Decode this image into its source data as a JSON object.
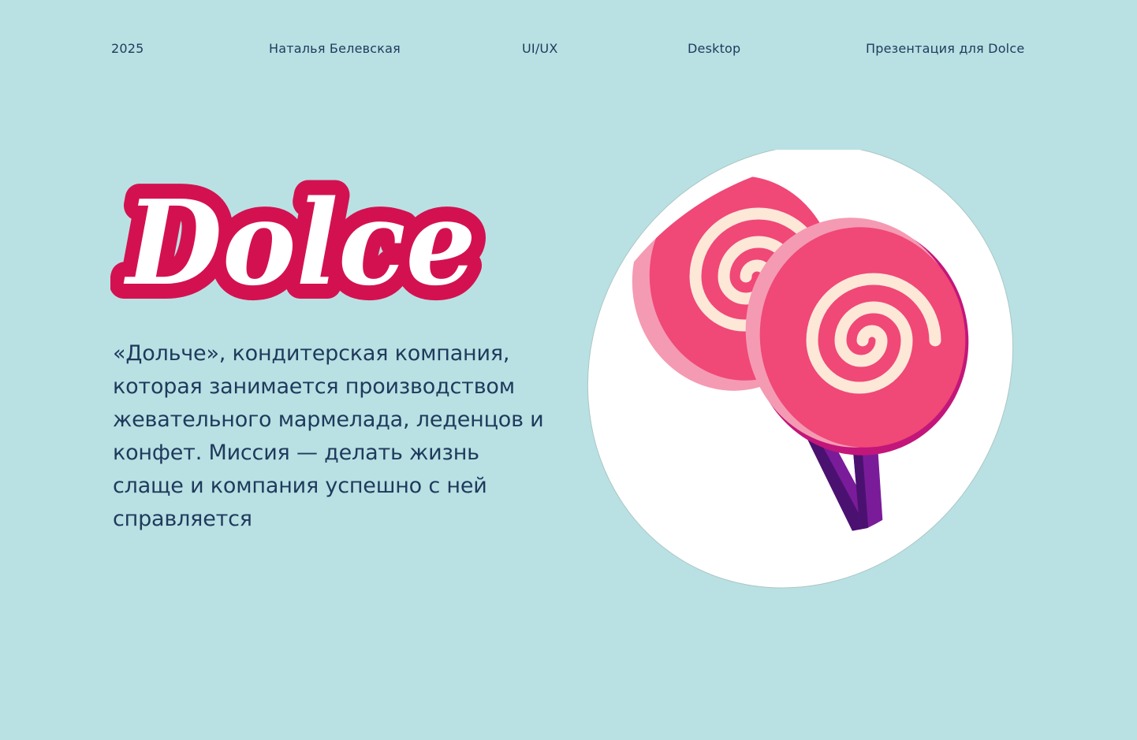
{
  "header": {
    "year": "2025",
    "author": "Наталья Белевская",
    "category": "UI/UX",
    "platform": "Desktop",
    "project": "Презентация для Dolce"
  },
  "logo": {
    "text": "Dolce"
  },
  "intro": {
    "text": "«Дольче», кондитерская компания, которая занимается производством жевательного мармелада, леденцов и конфет. Миссия — делать жизнь слаще и компания успешно с ней справляется"
  },
  "colors": {
    "background": "#b9e1e3",
    "text": "#1f3a5c",
    "brand": "#d41150",
    "candy_pink": "#f04877",
    "candy_cream": "#fde8d8",
    "stick_purple": "#7a1c99"
  },
  "illustration": {
    "icon": "lollipop-icon"
  }
}
